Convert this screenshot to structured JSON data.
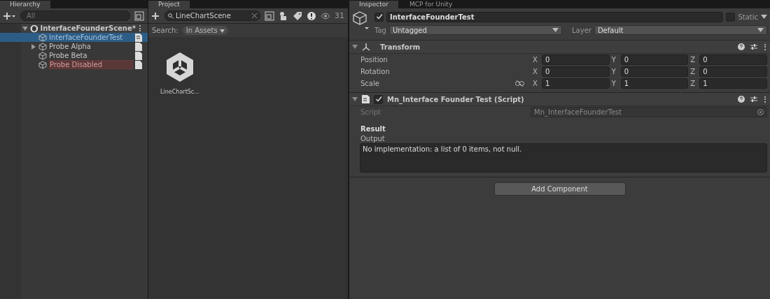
{
  "hierarchy": {
    "tab": "Hierarchy",
    "search_placeholder": "All",
    "scene": {
      "name": "InterfaceFounderScene*",
      "expanded": true
    },
    "items": [
      {
        "name": "InterfaceFounderTest",
        "selected": true,
        "disabled": false,
        "has_children": false,
        "script": true
      },
      {
        "name": "Probe Alpha",
        "selected": false,
        "disabled": false,
        "has_children": true,
        "script": false
      },
      {
        "name": "Probe Beta",
        "selected": false,
        "disabled": false,
        "has_children": false,
        "script": false
      },
      {
        "name": "Probe Disabled",
        "selected": false,
        "disabled": true,
        "has_children": false,
        "script": false
      }
    ]
  },
  "project": {
    "tab": "Project",
    "search_value": "LineChartScene",
    "count": "31",
    "search_label": "Search:",
    "scope": "In Assets",
    "assets": [
      {
        "name": "LineChartSc..."
      }
    ]
  },
  "inspector": {
    "tabs": [
      {
        "label": "Inspector",
        "selected": true
      },
      {
        "label": "MCP for Unity",
        "selected": false
      }
    ],
    "object": {
      "active": true,
      "name": "InterfaceFounderTest",
      "static_label": "Static",
      "static": false,
      "tag_label": "Tag",
      "tag": "Untagged",
      "layer_label": "Layer",
      "layer": "Default"
    },
    "transform": {
      "title": "Transform",
      "expanded": true,
      "rows": [
        {
          "label": "Position",
          "linked": false,
          "values": [
            {
              "axis": "X",
              "value": "0"
            },
            {
              "axis": "Y",
              "value": "0"
            },
            {
              "axis": "Z",
              "value": "0"
            }
          ]
        },
        {
          "label": "Rotation",
          "linked": false,
          "values": [
            {
              "axis": "X",
              "value": "0"
            },
            {
              "axis": "Y",
              "value": "0"
            },
            {
              "axis": "Z",
              "value": "0"
            }
          ]
        },
        {
          "label": "Scale",
          "linked": true,
          "values": [
            {
              "axis": "X",
              "value": "1"
            },
            {
              "axis": "Y",
              "value": "1"
            },
            {
              "axis": "Z",
              "value": "1"
            }
          ]
        }
      ]
    },
    "script_component": {
      "title": "Mn_Interface Founder Test (Script)",
      "enabled": true,
      "expanded": true,
      "script_label": "Script",
      "script_value": "Mn_InterfaceFounderTest",
      "section": "Result",
      "output_label": "Output",
      "output_value": "No implementation: a list of 0 items, not null."
    },
    "add_component": "Add Component"
  }
}
